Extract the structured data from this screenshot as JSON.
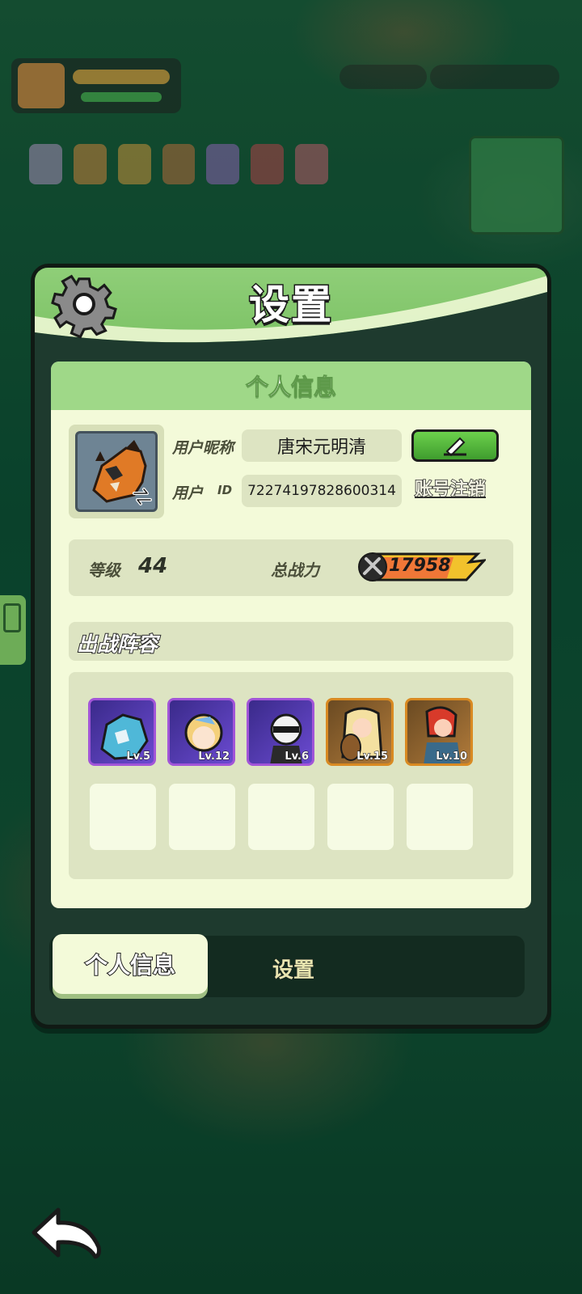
{
  "panel": {
    "title": "设置",
    "close_icon": "gear-icon"
  },
  "profile_card": {
    "header": "个人信息",
    "nickname_label": "用户昵称",
    "nickname_value": "唐宋元明清",
    "id_label": "用户",
    "id_suffix": "ID",
    "id_value": "72274197828600314",
    "cancel_account_label": "账号注销",
    "edit_icon": "pencil-icon",
    "avatar_icon": "swap-icon"
  },
  "stats": {
    "level_label": "等级",
    "level_value": "44",
    "power_label": "总战力",
    "power_value": "17958"
  },
  "lineup": {
    "title": "出战阵容",
    "heroes": [
      {
        "level": "Lv.5",
        "rarity": "purple"
      },
      {
        "level": "Lv.12",
        "rarity": "purple"
      },
      {
        "level": "Lv.6",
        "rarity": "purple"
      },
      {
        "level": "Lv.15",
        "rarity": "gold"
      },
      {
        "level": "Lv.10",
        "rarity": "gold"
      }
    ],
    "empty_slots": 5
  },
  "tabs": {
    "active": "个人信息",
    "inactive": "设置"
  },
  "colors": {
    "header_green": "#8fce78",
    "card_bg": "#f3fad9",
    "purple_rarity": "#a255d8",
    "gold_rarity": "#d98a22",
    "edit_green": "#4fb23a"
  }
}
